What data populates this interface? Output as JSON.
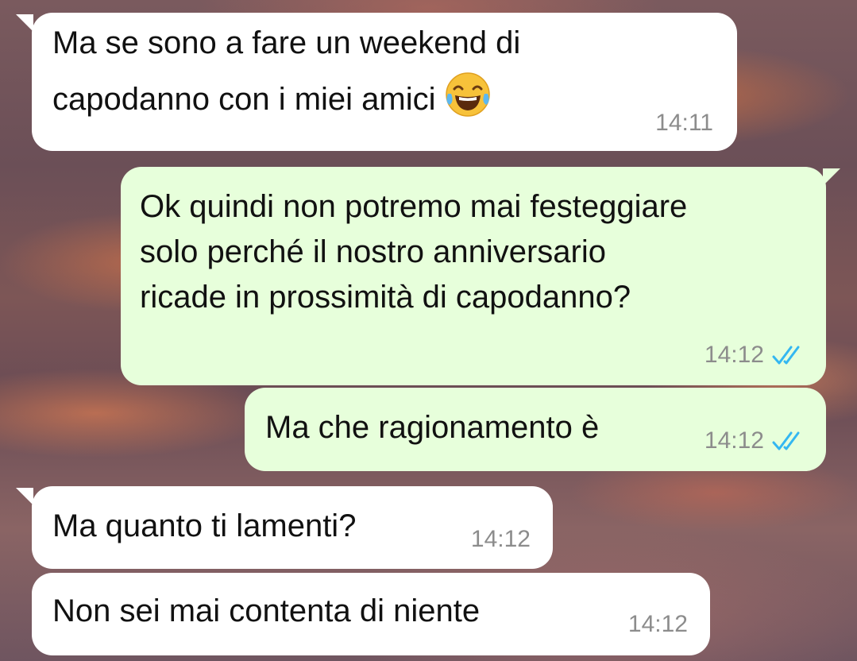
{
  "chat": {
    "messages": [
      {
        "direction": "in",
        "text_lines": [
          "Ma se sono a fare un weekend di",
          "capodanno con i miei amici"
        ],
        "emoji": "face-with-tears-of-joy-icon",
        "time": "14:11"
      },
      {
        "direction": "out",
        "text_lines": [
          "Ok quindi non potremo mai festeggiare",
          "solo perché il nostro anniversario",
          "ricade in prossimità di capodanno?"
        ],
        "time": "14:12",
        "status": "read"
      },
      {
        "direction": "out",
        "text_lines": [
          "Ma che ragionamento è"
        ],
        "time": "14:12",
        "status": "read"
      },
      {
        "direction": "in",
        "text_lines": [
          "Ma quanto ti lamenti?"
        ],
        "time": "14:12"
      },
      {
        "direction": "in",
        "text_lines": [
          "Non sei mai contenta di niente"
        ],
        "time": "14:12"
      }
    ]
  },
  "colors": {
    "incoming_bubble": "#ffffff",
    "outgoing_bubble": "#e7ffdb",
    "timestamp": "#8c8c8c",
    "read_ticks": "#34b7f1"
  }
}
